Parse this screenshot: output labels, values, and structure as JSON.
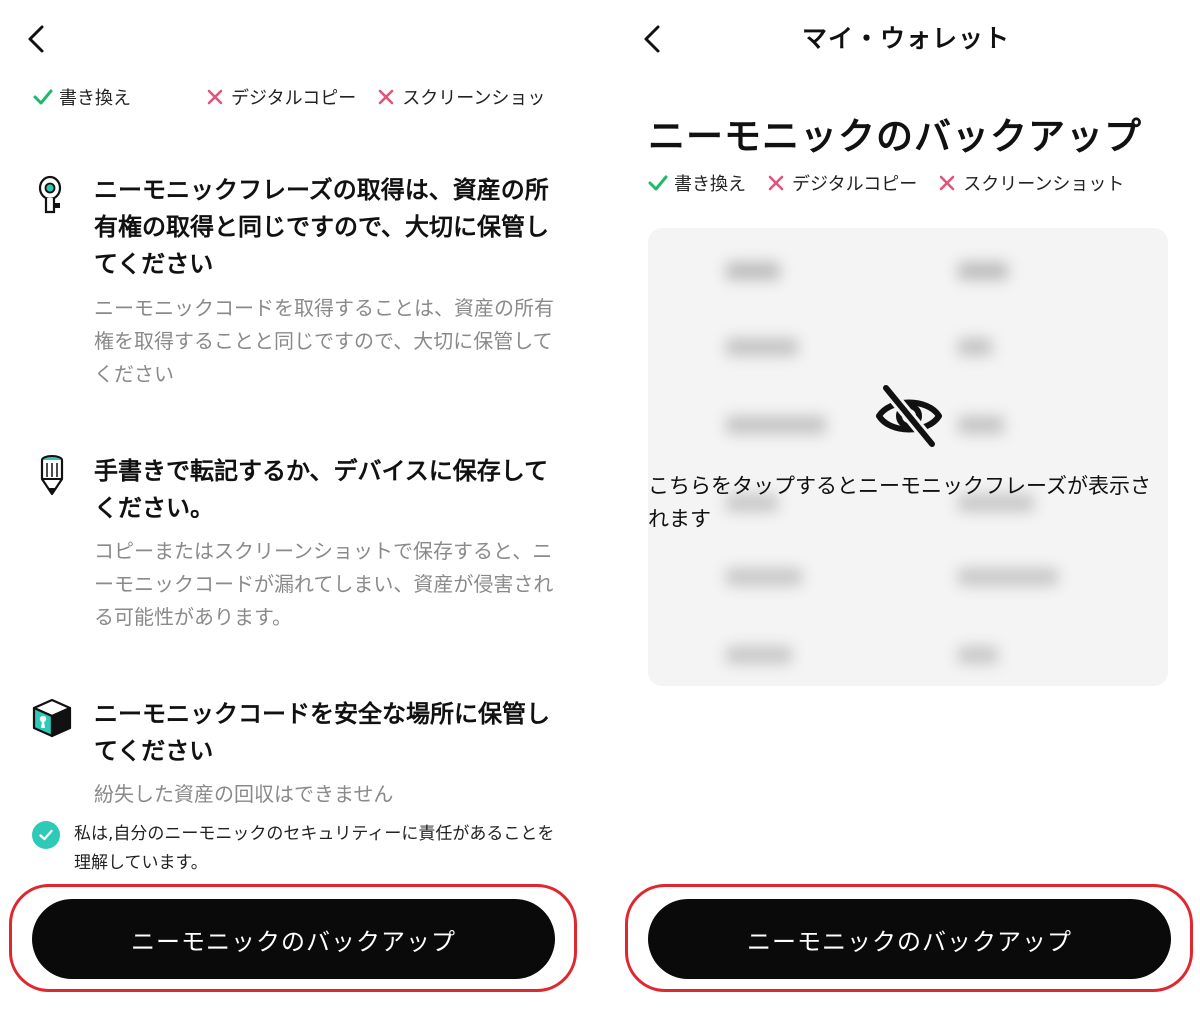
{
  "colors": {
    "accent": "#2ec9b7",
    "check": "#1fb96a",
    "cross": "#e0567a",
    "highlight": "#e0262e",
    "button": "#0a0a0a"
  },
  "left": {
    "tags": [
      {
        "icon": "check-icon",
        "label": "書き換え"
      },
      {
        "icon": "cross-icon",
        "label": "デジタルコピー"
      },
      {
        "icon": "cross-icon",
        "label": "スクリーンショッ"
      }
    ],
    "sections": [
      {
        "icon": "key-icon",
        "title": "ニーモニックフレーズの取得は、資産の所有権の取得と同じですので、大切に保管してください",
        "desc": "ニーモニックコードを取得することは、資産の所有権を取得することと同じですので、大切に保管してください"
      },
      {
        "icon": "pen-icon",
        "title": "手書きで転記するか、デバイスに保存してください。",
        "desc": "コピーまたはスクリーンショットで保存すると、ニーモニックコードが漏れてしまい、資産が侵害される可能性があります。"
      },
      {
        "icon": "safe-box-icon",
        "title": "ニーモニックコードを安全な場所に保管してください",
        "desc": "紛失した資産の回収はできません"
      }
    ],
    "confirm_text": "私は,自分のニーモニックのセキュリティーに責任があることを理解しています。",
    "button_label": "ニーモニックのバックアップ"
  },
  "right": {
    "nav_title": "マイ・ウォレット",
    "page_title": "ニーモニックのバックアップ",
    "tags": [
      {
        "icon": "check-icon",
        "label": "書き換え"
      },
      {
        "icon": "cross-icon",
        "label": "デジタルコピー"
      },
      {
        "icon": "cross-icon",
        "label": "スクリーンショット"
      }
    ],
    "reveal_text": "こちらをタップするとニーモニックフレーズが表示されます",
    "button_label": "ニーモニックのバックアップ"
  }
}
